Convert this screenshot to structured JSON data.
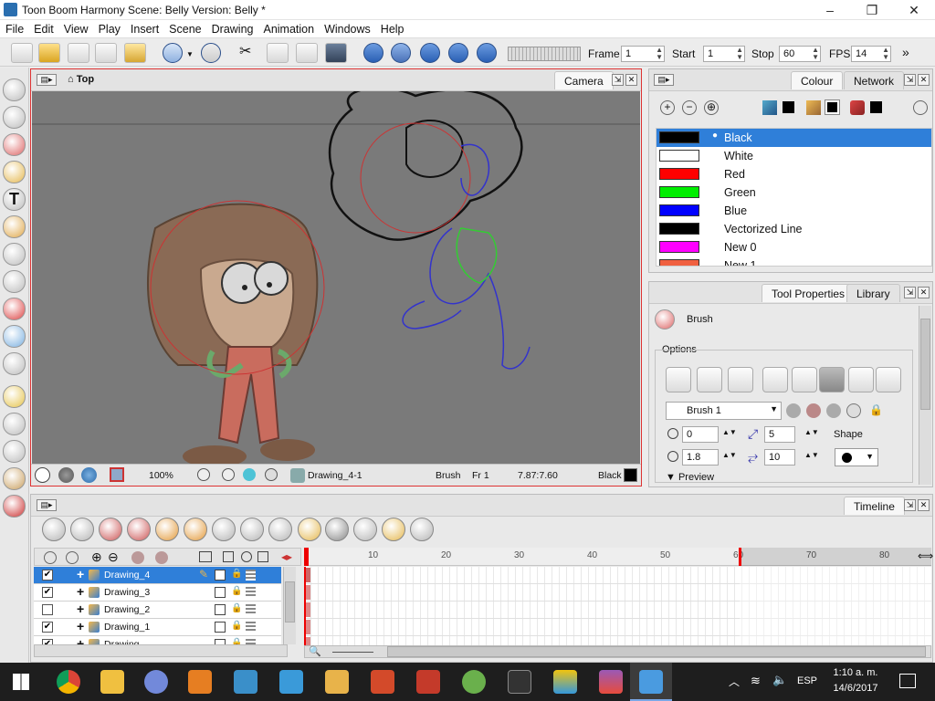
{
  "window": {
    "title": "Toon Boom Harmony Scene: Belly Version: Belly *",
    "minimize": "–",
    "maximize": "❐",
    "close": "✕"
  },
  "menu": [
    "File",
    "Edit",
    "View",
    "Play",
    "Insert",
    "Scene",
    "Drawing",
    "Animation",
    "Windows",
    "Help"
  ],
  "playback": {
    "frame_label": "Frame",
    "frame_value": "1",
    "start_label": "Start",
    "start_value": "1",
    "stop_label": "Stop",
    "stop_value": "60",
    "fps_label": "FPS",
    "fps_value": "14",
    "more": "»"
  },
  "camera_view": {
    "breadcrumb": "Top",
    "tab": "Camera",
    "status": {
      "zoom": "100%",
      "drawing": "Drawing_4-1",
      "tool": "Brush",
      "frame": "Fr 1",
      "coords": "7.87:7.60",
      "color_name": "Black"
    }
  },
  "colour_panel": {
    "tabs": [
      "Colour",
      "Network"
    ],
    "swatches": [
      {
        "name": "Black",
        "hex": "#000000",
        "selected": true
      },
      {
        "name": "White",
        "hex": "#ffffff",
        "selected": false
      },
      {
        "name": "Red",
        "hex": "#ff0000",
        "selected": false
      },
      {
        "name": "Green",
        "hex": "#00ee00",
        "selected": false
      },
      {
        "name": "Blue",
        "hex": "#0000ff",
        "selected": false
      },
      {
        "name": "Vectorized Line",
        "hex": "#000000",
        "selected": false
      },
      {
        "name": "New 0",
        "hex": "#ff00ff",
        "selected": false
      },
      {
        "name": "New 1",
        "hex": "#f06040",
        "selected": false
      }
    ]
  },
  "tool_properties": {
    "tabs": [
      "Tool Properties",
      "Library"
    ],
    "tool_name": "Brush",
    "options_label": "Options",
    "preset": "Brush 1",
    "min_size": "0",
    "max_size": "5",
    "smoothness": "1.8",
    "contour": "10",
    "shape_label": "Shape",
    "preview_label": "Preview"
  },
  "timeline": {
    "tab": "Timeline",
    "layers": [
      {
        "name": "Drawing_4",
        "checked": true,
        "selected": true
      },
      {
        "name": "Drawing_3",
        "checked": true,
        "selected": false
      },
      {
        "name": "Drawing_2",
        "checked": false,
        "selected": false
      },
      {
        "name": "Drawing_1",
        "checked": true,
        "selected": false
      },
      {
        "name": "Drawing",
        "checked": true,
        "selected": false
      }
    ],
    "ruler_marks": [
      "10",
      "20",
      "30",
      "40",
      "50",
      "60",
      "70",
      "80"
    ],
    "stop_frame": 60
  },
  "taskbar": {
    "time": "1:10 a. m.",
    "date": "14/6/2017",
    "language": "ESP",
    "tray_up": "︿"
  }
}
